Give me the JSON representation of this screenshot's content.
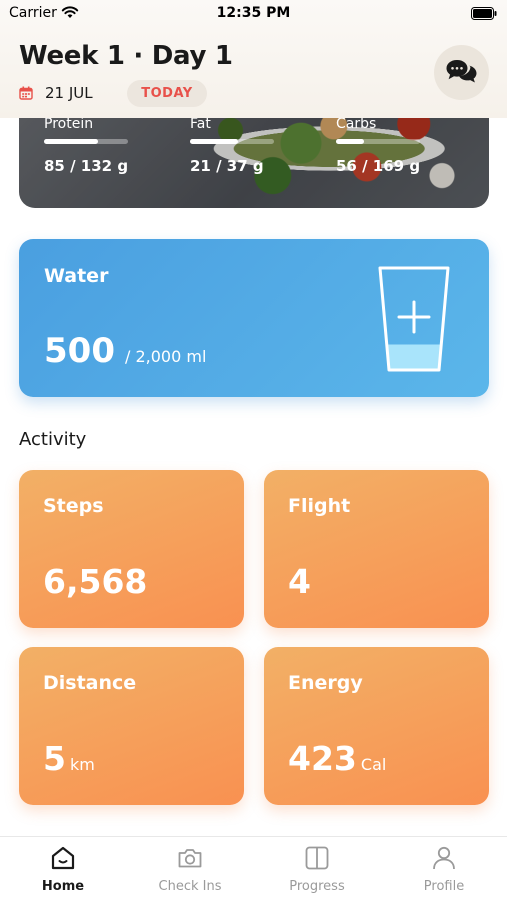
{
  "status_bar": {
    "carrier": "Carrier",
    "time": "12:35 PM"
  },
  "header": {
    "title": "Week 1 · Day 1",
    "date": "21 JUL",
    "today_badge": "TODAY",
    "chat_icon": "chat-bubbles-icon"
  },
  "macros": [
    {
      "name": "Protein",
      "value": "85 / 132 g",
      "progress": 0.64
    },
    {
      "name": "Fat",
      "value": "21 / 37 g",
      "progress": 0.57
    },
    {
      "name": "Carbs",
      "value": "56 / 169 g",
      "progress": 0.33
    }
  ],
  "water": {
    "title": "Water",
    "amount": "500",
    "goal": "/  2,000 ml",
    "fill_level": 0.25,
    "icon": "glass-plus-icon"
  },
  "activity": {
    "heading": "Activity",
    "tiles": [
      {
        "label": "Steps",
        "value": "6,568",
        "unit": ""
      },
      {
        "label": "Flight",
        "value": "4",
        "unit": ""
      },
      {
        "label": "Distance",
        "value": "5",
        "unit": "km"
      },
      {
        "label": "Energy",
        "value": "423",
        "unit": "Cal"
      }
    ]
  },
  "tab_bar": {
    "tabs": [
      {
        "label": "Home",
        "icon": "home-icon",
        "active": true
      },
      {
        "label": "Check Ins",
        "icon": "camera-icon",
        "active": false
      },
      {
        "label": "Progress",
        "icon": "progress-panel-icon",
        "active": false
      },
      {
        "label": "Profile",
        "icon": "user-icon",
        "active": false
      }
    ]
  },
  "colors": {
    "water_card": "#4a9fe0",
    "activity_tile": "#f99151",
    "today_badge_text": "#e8514a",
    "calendar_icon": "#e8514a"
  }
}
